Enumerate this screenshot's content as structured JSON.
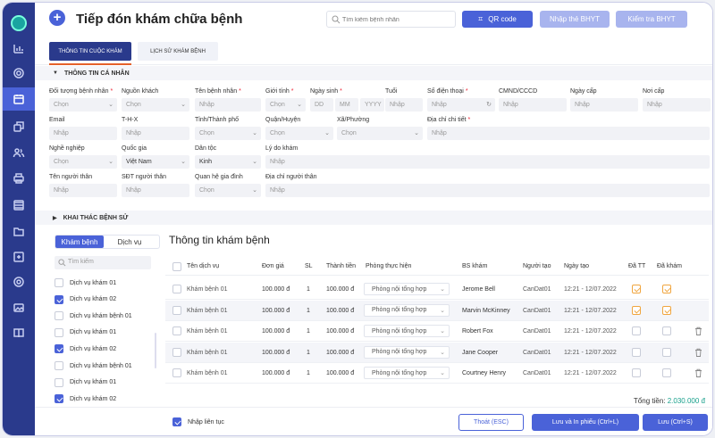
{
  "header": {
    "title": "Tiếp đón khám chữa bệnh",
    "search_placeholder": "Tìm kiếm bệnh nhân",
    "qr_label": "QR code",
    "insurance_enter_label": "Nhập thẻ BHYT",
    "insurance_check_label": "Kiểm tra BHYT"
  },
  "tabs": [
    {
      "label": "THÔNG TIN CUỘC KHÁM"
    },
    {
      "label": "LỊCH SỬ KHÁM BỆNH"
    }
  ],
  "sections": {
    "personal": "THÔNG TIN CÁ NHÂN",
    "history": "KHAI THÁC BỆNH SỬ"
  },
  "form": {
    "row1": [
      {
        "label": "Đối tượng bệnh nhân",
        "req": "*",
        "value": "Chọn"
      },
      {
        "label": "Nguồn khách",
        "req": "",
        "value": "Chọn"
      },
      {
        "label": "Tên bệnh nhân",
        "req": "*",
        "value": "Nhập"
      },
      {
        "label": "Giới tính",
        "req": "*",
        "value": "Chọn"
      },
      {
        "label": "Ngày sinh",
        "req": "*",
        "dd": "DD",
        "mm": "MM",
        "yyyy": "YYYY"
      },
      {
        "label": "Tuổi",
        "req": "",
        "value": "Nhập"
      },
      {
        "label": "Số điện thoại",
        "req": "*",
        "value": "Nhập"
      },
      {
        "label": "CMND/CCCD",
        "req": "",
        "value": "Nhập"
      },
      {
        "label": "Ngày cấp",
        "req": "",
        "value": "Nhập"
      },
      {
        "label": "Nơi cấp",
        "req": "",
        "value": "Nhập"
      }
    ],
    "row2": [
      {
        "label": "Email",
        "req": "",
        "value": "Nhập"
      },
      {
        "label": "T-H-X",
        "req": "",
        "value": "Nhập"
      },
      {
        "label": "Tỉnh/Thành phố",
        "req": "",
        "value": "Chọn"
      },
      {
        "label": "Quận/Huyện",
        "req": "",
        "value": "Chọn"
      },
      {
        "label": "Xã/Phường",
        "req": "",
        "value": "Chọn"
      },
      {
        "label": "Địa chỉ chi tiết",
        "req": "*",
        "value": "Nhập"
      }
    ],
    "row3": [
      {
        "label": "Nghề nghiệp",
        "req": "",
        "value": "Chọn"
      },
      {
        "label": "Quốc gia",
        "req": "",
        "value": "Việt Nam"
      },
      {
        "label": "Dân tộc",
        "req": "",
        "value": "Kinh"
      },
      {
        "label": "Lý do khám",
        "req": "",
        "value": "Nhập"
      }
    ],
    "row4": [
      {
        "label": "Tên người thân",
        "req": "",
        "value": "Nhập"
      },
      {
        "label": "SĐT người thân",
        "req": "",
        "value": "Nhập"
      },
      {
        "label": "Quan hệ gia đình",
        "req": "",
        "value": "Chọn"
      },
      {
        "label": "Địa chỉ người thân",
        "req": "",
        "value": "Nhập"
      }
    ]
  },
  "left_panel": {
    "tab_exam": "Khám bệnh",
    "tab_service": "Dịch vụ",
    "search_placeholder": "Tìm kiếm",
    "items": [
      {
        "label": "Dịch vụ khám 01",
        "checked": false
      },
      {
        "label": "Dịch vụ khám 02",
        "checked": true
      },
      {
        "label": "Dịch vụ khám bệnh 01",
        "checked": false
      },
      {
        "label": "Dịch vụ khám 01",
        "checked": false
      },
      {
        "label": "Dịch vụ khám 02",
        "checked": true
      },
      {
        "label": "Dịch vụ khám bệnh 01",
        "checked": false
      },
      {
        "label": "Dịch vụ khám 01",
        "checked": false
      },
      {
        "label": "Dịch vụ khám 02",
        "checked": true
      }
    ]
  },
  "table": {
    "title": "Thông tin khám bệnh",
    "columns": [
      "Tên dịch vụ",
      "Đơn giá",
      "SL",
      "Thành tiền",
      "Phòng thực hiện",
      "BS khám",
      "Người tạo",
      "Ngày tạo",
      "Đã TT",
      "Đã khám"
    ],
    "rows": [
      {
        "service": "Khám bệnh 01",
        "price": "100.000 đ",
        "qty": "1",
        "amount": "100.000 đ",
        "room": "Phòng nội tổng hợp",
        "doctor": "Jerome Bell",
        "creator": "CanDat01",
        "date": "12:21 - 12/07.2022",
        "paid": true,
        "examined": true
      },
      {
        "service": "Khám bệnh 01",
        "price": "100.000 đ",
        "qty": "1",
        "amount": "100.000 đ",
        "room": "Phòng nội tổng hợp",
        "doctor": "Marvin McKinney",
        "creator": "CanDat01",
        "date": "12:21 - 12/07.2022",
        "paid": true,
        "examined": true
      },
      {
        "service": "Khám bệnh 01",
        "price": "100.000 đ",
        "qty": "1",
        "amount": "100.000 đ",
        "room": "Phòng nội tổng hợp",
        "doctor": "Robert Fox",
        "creator": "CanDat01",
        "date": "12:21 - 12/07.2022",
        "paid": false,
        "examined": false
      },
      {
        "service": "Khám bệnh 01",
        "price": "100.000 đ",
        "qty": "1",
        "amount": "100.000 đ",
        "room": "Phòng nội tổng hợp",
        "doctor": "Jane Cooper",
        "creator": "CanDat01",
        "date": "12:21 - 12/07.2022",
        "paid": false,
        "examined": false
      },
      {
        "service": "Khám bệnh 01",
        "price": "100.000 đ",
        "qty": "1",
        "amount": "100.000 đ",
        "room": "Phòng nội tổng hợp",
        "doctor": "Courtney Henry",
        "creator": "CanDat01",
        "date": "12:21 - 12/07.2022",
        "paid": false,
        "examined": false
      }
    ],
    "total_label": "Tổng tiền:",
    "total_value": "2.030.000 đ"
  },
  "footer": {
    "continuous_label": "Nhập liên tục",
    "exit_label": "Thoát (ESC)",
    "save_print_label": "Lưu và In phiếu (Ctrl+L)",
    "save_label": "Lưu (Ctrl+S)"
  },
  "colors": {
    "primary": "#4a62d8",
    "rail": "#2a3a8c",
    "accent": "#e5612a",
    "success": "#18a08c",
    "warn": "#f0a640"
  }
}
